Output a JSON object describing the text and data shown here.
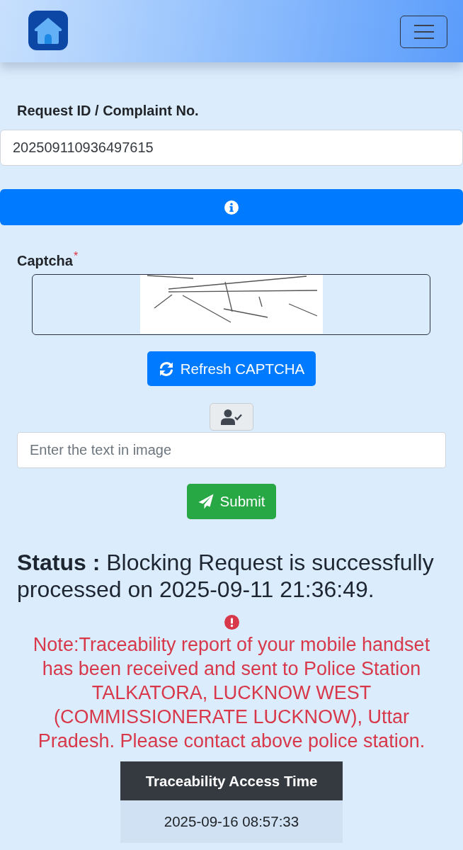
{
  "request_field": {
    "label": "Request ID / Complaint No.",
    "value": "202509110936497615"
  },
  "captcha": {
    "label": "Captcha",
    "required_mark": "*",
    "refresh_button": "Refresh CAPTCHA",
    "input": {
      "placeholder": "Enter the text in image"
    }
  },
  "submit_button": "Submit",
  "status": "**Status :** Blocking Request is successfully processed on 2025-09-11 21:36:49.",
  "note": "Note:Traceability report of your mobile handset has been received and sent to Police Station TALKATORA, LUCKNOW WEST (COMMISSIONERATE LUCKNOW), Uttar Pradesh. Please contact above police station.",
  "table": {
    "columns": [
      "Traceability Access Time"
    ],
    "rows": [
      [
        "2025-09-16 08:57:33"
      ]
    ]
  }
}
